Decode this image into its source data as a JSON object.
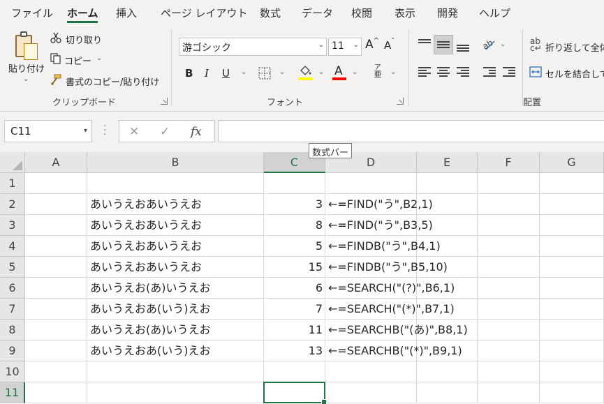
{
  "tabs": [
    "ファイル",
    "ホーム",
    "挿入",
    "ページ レイアウト",
    "数式",
    "データ",
    "校閲",
    "表示",
    "開発",
    "ヘルプ"
  ],
  "clipboard": {
    "paste": "貼り付け",
    "cut": "切り取り",
    "copy": "コピー",
    "format_painter": "書式のコピー/貼り付け",
    "group_label": "クリップボード"
  },
  "font": {
    "name": "游ゴシック",
    "size": "11",
    "grow": "A",
    "shrink": "A",
    "bold": "B",
    "italic": "I",
    "underline": "U",
    "font_color_letter": "A",
    "phonetic_top": "ア",
    "phonetic_bottom": "亜",
    "group_label": "フォント",
    "fill_color": "#ffff00",
    "font_color": "#ff0000"
  },
  "alignment": {
    "wrap_text": "折り返して全体",
    "merge_center": "セルを結合して",
    "group_label": "配置"
  },
  "formula_bar": {
    "name_box": "C11",
    "cancel": "✕",
    "enter": "✓",
    "fx": "fx",
    "formula": "",
    "tooltip": "数式バー"
  },
  "columns": [
    "A",
    "B",
    "C",
    "D",
    "E",
    "F",
    "G"
  ],
  "rows": [
    "1",
    "2",
    "3",
    "4",
    "5",
    "6",
    "7",
    "8",
    "9",
    "10",
    "11"
  ],
  "selected": {
    "column": "C",
    "row": "11"
  },
  "cells": {
    "B2": "あいうえおあいうえお",
    "C2": "3",
    "D2": "←=FIND(\"う\",B2,1)",
    "B3": "あいうえおあいうえお",
    "C3": "8",
    "D3": "←=FIND(\"う\",B3,5)",
    "B4": "あいうえおあいうえお",
    "C4": "5",
    "D4": "←=FINDB(\"う\",B4,1)",
    "B5": "あいうえおあいうえお",
    "C5": "15",
    "D5": "←=FINDB(\"う\",B5,10)",
    "B6": "あいうえお(あ)いうえお",
    "C6": "6",
    "D6": "←=SEARCH(\"(?)\",B6,1)",
    "B7": "あいうえおあ(いう)えお",
    "C7": "7",
    "D7": "←=SEARCH(\"(*)\",B7,1)",
    "B8": "あいうえお(あ)いうえお",
    "C8": "11",
    "D8": "←=SEARCHB(\"(あ)\",B8,1)",
    "B9": "あいうえおあ(いう)えお",
    "C9": "13",
    "D9": "←=SEARCHB(\"(*)\",B9,1)"
  },
  "accent_color": "#217346"
}
